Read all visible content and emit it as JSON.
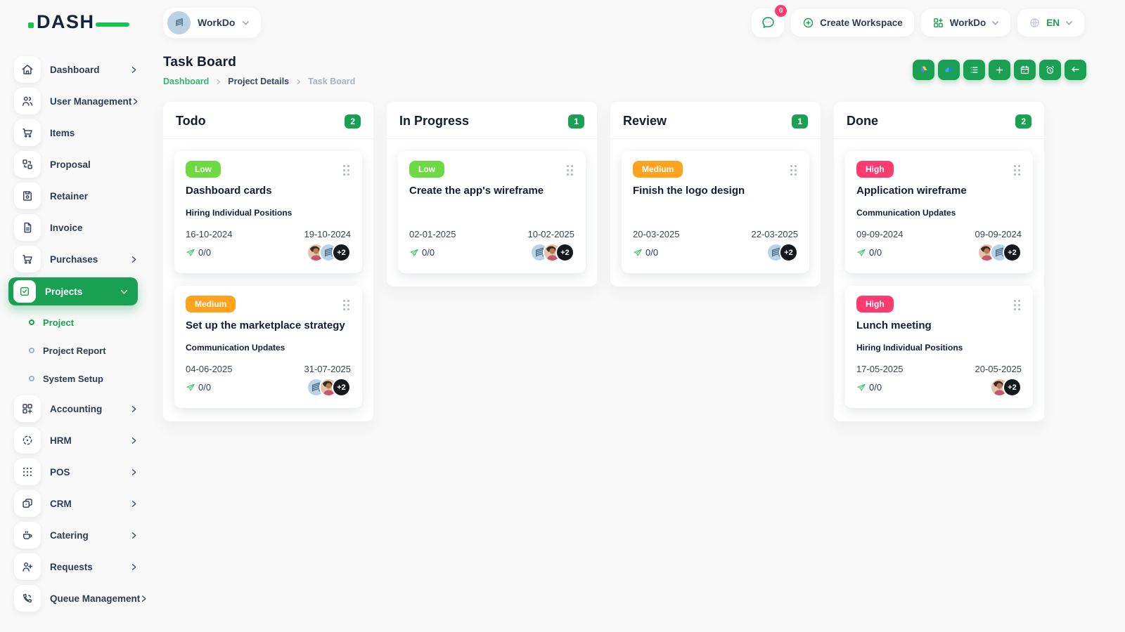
{
  "brand": {
    "name": "DASH"
  },
  "topbar": {
    "workspace_name": "WorkDo",
    "chat_badge": "0",
    "create_workspace_label": "Create Workspace",
    "workspace_menu_label": "WorkDo",
    "language": "EN"
  },
  "sidebar": {
    "items": [
      {
        "label": "Dashboard"
      },
      {
        "label": "User Management"
      },
      {
        "label": "Items"
      },
      {
        "label": "Proposal"
      },
      {
        "label": "Retainer"
      },
      {
        "label": "Invoice"
      },
      {
        "label": "Purchases"
      },
      {
        "label": "Projects"
      },
      {
        "label": "Accounting"
      },
      {
        "label": "HRM"
      },
      {
        "label": "POS"
      },
      {
        "label": "CRM"
      },
      {
        "label": "Catering"
      },
      {
        "label": "Requests"
      },
      {
        "label": "Queue Management"
      }
    ],
    "projects_submenu": [
      {
        "label": "Project"
      },
      {
        "label": "Project Report"
      },
      {
        "label": "System Setup"
      }
    ]
  },
  "page": {
    "title": "Task Board",
    "breadcrumb": {
      "items": [
        "Dashboard",
        "Project Details",
        "Task Board"
      ]
    }
  },
  "toolbar": {
    "buttons": [
      "google-drive",
      "onedrive",
      "list",
      "add",
      "calendar",
      "reminder",
      "back"
    ]
  },
  "board": {
    "columns": [
      {
        "title": "Todo",
        "count": "2",
        "cards": [
          {
            "priority": "Low",
            "title": "Dashboard cards",
            "milestone": "Hiring Individual Positions",
            "start_date": "16-10-2024",
            "end_date": "19-10-2024",
            "progress": "0/0",
            "more": "+2"
          },
          {
            "priority": "Medium",
            "title": "Set up the marketplace strategy",
            "milestone": "Communication Updates",
            "start_date": "04-06-2025",
            "end_date": "31-07-2025",
            "progress": "0/0",
            "more": "+2"
          }
        ]
      },
      {
        "title": "In Progress",
        "count": "1",
        "cards": [
          {
            "priority": "Low",
            "title": "Create the app's wireframe",
            "milestone": "",
            "start_date": "02-01-2025",
            "end_date": "10-02-2025",
            "progress": "0/0",
            "more": "+2"
          }
        ]
      },
      {
        "title": "Review",
        "count": "1",
        "cards": [
          {
            "priority": "Medium",
            "title": "Finish the logo design",
            "milestone": "",
            "start_date": "20-03-2025",
            "end_date": "22-03-2025",
            "progress": "0/0",
            "more": "+2"
          }
        ]
      },
      {
        "title": "Done",
        "count": "2",
        "cards": [
          {
            "priority": "High",
            "title": "Application wireframe",
            "milestone": "Communication Updates",
            "start_date": "09-09-2024",
            "end_date": "09-09-2024",
            "progress": "0/0",
            "more": "+2"
          },
          {
            "priority": "High",
            "title": "Lunch meeting",
            "milestone": "Hiring Individual Positions",
            "start_date": "17-05-2025",
            "end_date": "20-05-2025",
            "progress": "0/0",
            "more": "+2"
          }
        ]
      }
    ]
  },
  "colors": {
    "primary_green": "#1aa053",
    "low_badge": "#6fd943",
    "medium_badge": "#ffa21d",
    "high_badge": "#ff3a6e",
    "text_dark": "#141e30"
  }
}
